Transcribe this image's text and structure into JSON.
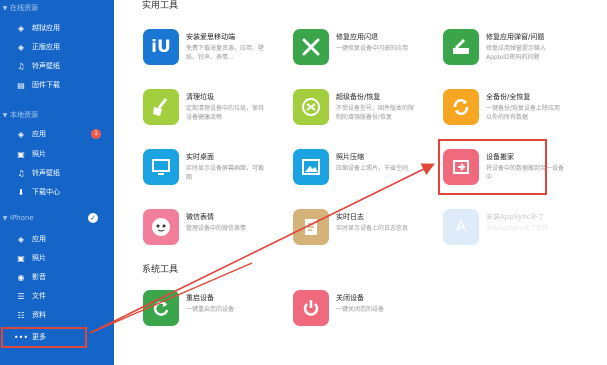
{
  "sidebar": {
    "online": {
      "title": "在线资源",
      "items": [
        {
          "label": "越狱应用"
        },
        {
          "label": "正版应用"
        },
        {
          "label": "铃声壁纸"
        },
        {
          "label": "固件下载"
        }
      ]
    },
    "local": {
      "title": "本地资源",
      "items": [
        {
          "label": "应用",
          "badge": "1"
        },
        {
          "label": "照片"
        },
        {
          "label": "铃声壁纸"
        },
        {
          "label": "下载中心"
        }
      ]
    },
    "iphone": {
      "title": "iPhone",
      "items": [
        {
          "label": "应用"
        },
        {
          "label": "照片"
        },
        {
          "label": "影音"
        },
        {
          "label": "文件"
        },
        {
          "label": "资料"
        },
        {
          "label": "更多"
        }
      ]
    }
  },
  "main": {
    "utilities_title": "实用工具",
    "system_title": "系统工具",
    "tools": [
      {
        "title": "安装爱思移动端",
        "desc": "免费下载海量资源，应用、壁纸、铃声、表情..."
      },
      {
        "title": "修复应用闪退",
        "desc": "一键修复设备中闪退的应用"
      },
      {
        "title": "修复应用弹窗/问题",
        "desc": "修复应用弹窗提示输入AppleID密码的问题"
      },
      {
        "title": "清理垃圾",
        "desc": "定期清理设备中的垃圾，保持设备健康流畅"
      },
      {
        "title": "超级备份/恢复",
        "desc": "不受设备型号、固件版本的限制的增强版备份/恢复"
      },
      {
        "title": "全备份/全恢复",
        "desc": "一键备份/恢复设备上除应用以外的所有数据"
      },
      {
        "title": "实时桌面",
        "desc": "实时显示设备屏幕画面，可截图"
      },
      {
        "title": "照片压缩",
        "desc": "压缩设备上照片，节省空间"
      },
      {
        "title": "设备搬家",
        "desc": "将设备中的数据搬到另一设备中"
      },
      {
        "title": "微信表情",
        "desc": "管理设备中的微信表情"
      },
      {
        "title": "实时日志",
        "desc": "实时显示设备上的日志信息"
      },
      {
        "title": "安装AppSync补丁",
        "desc": "安装AppSync补丁后可..."
      }
    ],
    "system_tools": [
      {
        "title": "重启设备",
        "desc": "一键重启您的设备"
      },
      {
        "title": "关闭设备",
        "desc": "一键关闭您的设备"
      }
    ]
  },
  "colors": {
    "sidebar": "#1565c8",
    "highlight": "#e0463a"
  }
}
